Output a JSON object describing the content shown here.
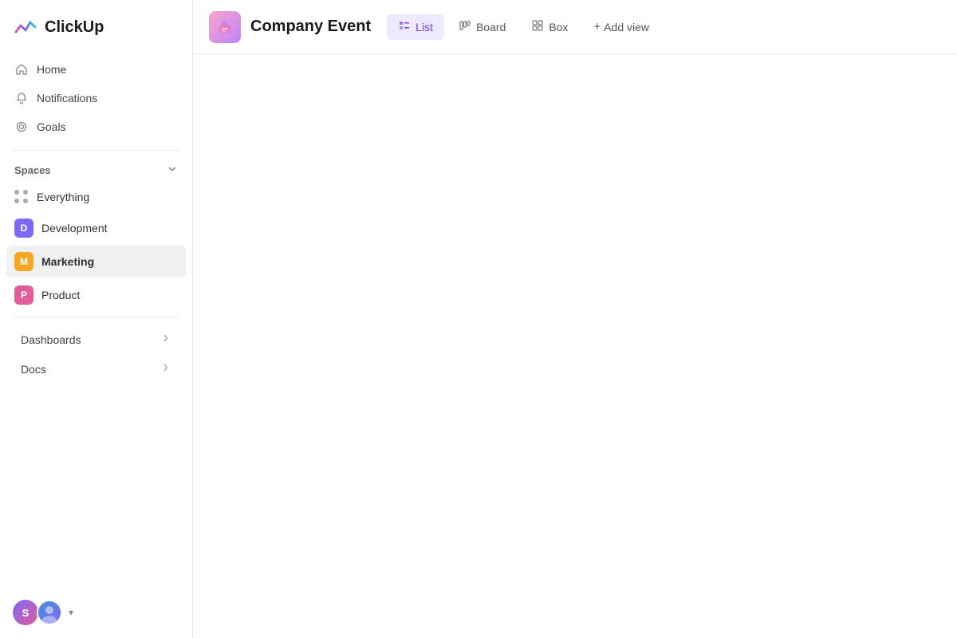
{
  "logo": {
    "text": "ClickUp"
  },
  "sidebar": {
    "nav": [
      {
        "id": "home",
        "label": "Home",
        "icon": "⌂"
      },
      {
        "id": "notifications",
        "label": "Notifications",
        "icon": "🔔"
      },
      {
        "id": "goals",
        "label": "Goals",
        "icon": "🎯"
      }
    ],
    "spaces_label": "Spaces",
    "spaces": [
      {
        "id": "everything",
        "label": "Everything",
        "type": "dots"
      },
      {
        "id": "development",
        "label": "Development",
        "type": "badge",
        "badge": "D",
        "badgeClass": "badge-d"
      },
      {
        "id": "marketing",
        "label": "Marketing",
        "type": "badge",
        "badge": "M",
        "badgeClass": "badge-m",
        "active": true
      },
      {
        "id": "product",
        "label": "Product",
        "type": "badge",
        "badge": "P",
        "badgeClass": "badge-p"
      }
    ],
    "sections": [
      {
        "id": "dashboards",
        "label": "Dashboards"
      },
      {
        "id": "docs",
        "label": "Docs"
      }
    ],
    "user": {
      "initials": "S",
      "dropdown": "▾"
    }
  },
  "header": {
    "page_title": "Company Event",
    "views": [
      {
        "id": "list",
        "label": "List",
        "active": true
      },
      {
        "id": "board",
        "label": "Board",
        "active": false
      },
      {
        "id": "box",
        "label": "Box",
        "active": false
      }
    ],
    "add_view_label": "Add view"
  }
}
